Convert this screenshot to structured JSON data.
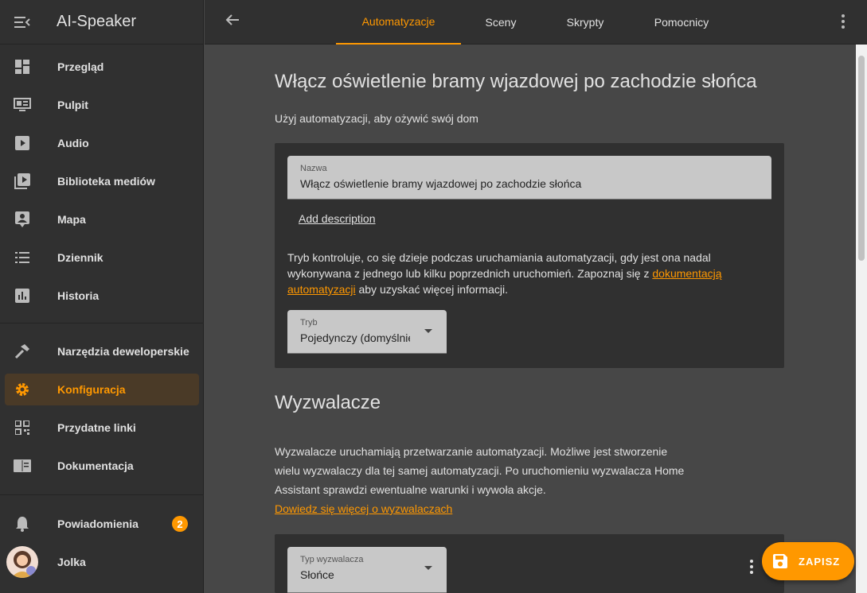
{
  "sidebar": {
    "title": "AI-Speaker",
    "items": [
      {
        "label": "Przegląd",
        "icon": "dashboard-icon"
      },
      {
        "label": "Pulpit",
        "icon": "monitor-dashboard-icon"
      },
      {
        "label": "Audio",
        "icon": "play-box-icon"
      },
      {
        "label": "Biblioteka mediów",
        "icon": "media-library-icon"
      },
      {
        "label": "Mapa",
        "icon": "map-account-icon"
      },
      {
        "label": "Dziennik",
        "icon": "format-list-icon"
      },
      {
        "label": "Historia",
        "icon": "chart-box-icon"
      },
      {
        "label": "Narzędzia deweloperskie",
        "icon": "hammer-icon"
      },
      {
        "label": "Konfiguracja",
        "icon": "cog-icon"
      },
      {
        "label": "Przydatne linki",
        "icon": "qrcode-icon"
      },
      {
        "label": "Dokumentacja",
        "icon": "book-open-icon"
      }
    ],
    "notifications": {
      "label": "Powiadomienia",
      "count": "2"
    },
    "user": {
      "name": "Jolka"
    }
  },
  "topbar": {
    "tabs": [
      "Automatyzacje",
      "Sceny",
      "Skrypty",
      "Pomocnicy"
    ],
    "active_tab": "Automatyzacje"
  },
  "main": {
    "title": "Włącz oświetlenie bramy wjazdowej po zachodzie słońca",
    "subtitle": "Użyj automatyzacji, aby ożywić swój dom",
    "name_field": {
      "label": "Nazwa",
      "value": "Włącz oświetlenie bramy wjazdowej po zachodzie słońca"
    },
    "add_description": "Add description",
    "mode_text_1": "Tryb kontroluje, co się dzieje podczas uruchamiania automatyzacji, gdy jest ona nadal wykonywana z jednego lub kilku poprzednich uruchomień. Zapoznaj się z ",
    "mode_link": "dokumentacją automatyzacji",
    "mode_text_2": " aby uzyskać więcej informacji.",
    "mode_field": {
      "label": "Tryb",
      "value": "Pojedynczy (domyślnie)"
    },
    "triggers_title": "Wyzwalacze",
    "triggers_text": "Wyzwalacze uruchamiają przetwarzanie automatyzacji. Możliwe jest stworzenie wielu wyzwalaczy dla tej samej automatyzacji. Po uruchomieniu wyzwalacza Home Assistant sprawdzi ewentualne warunki i wywoła akcje.",
    "triggers_link": "Dowiedz się więcej o wyzwalaczach",
    "trigger_type_field": {
      "label": "Typ wyzwalacza",
      "value": "Słońce"
    }
  },
  "fab": {
    "label": "ZAPISZ"
  },
  "colors": {
    "accent": "#ff9800",
    "sidebar_bg": "#303030",
    "main_bg": "#474747"
  }
}
